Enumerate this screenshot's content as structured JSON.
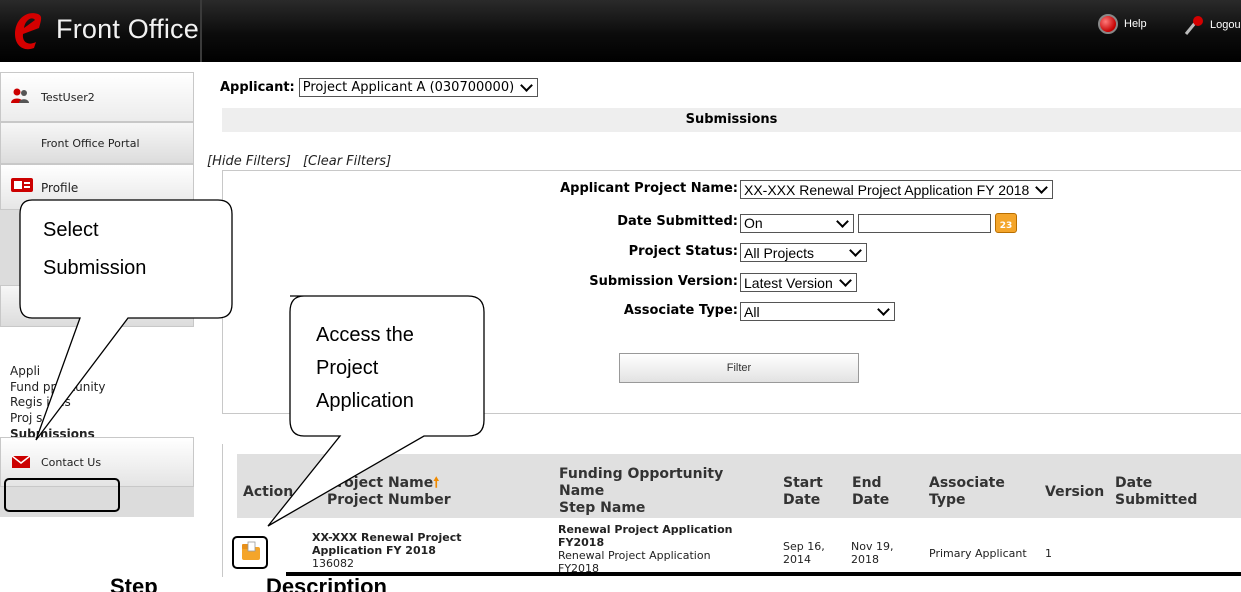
{
  "header": {
    "logo_letter": "e",
    "app_title": "Front Office",
    "help_label": "Help",
    "logout_label": "Logou"
  },
  "sidebar": {
    "user_name": "TestUser2",
    "portal_label": "Front Office Portal",
    "profile_label": "Profile",
    "links": [
      "Appli",
      "Fund  pportunity",
      "Regis   ions",
      "Proj   s",
      "Submissions"
    ],
    "contact_label": "Contact Us"
  },
  "main": {
    "applicant_label": "Applicant:",
    "applicant_value": "Project Applicant A (030700000)",
    "section_title": "Submissions",
    "hide_filters": "[Hide Filters]",
    "clear_filters": "[Clear Filters]",
    "filters": {
      "project_name_label": "Applicant Project Name:",
      "project_name_value": "XX-XXX Renewal Project Application FY 2018",
      "date_label": "Date Submitted:",
      "date_mode": "On",
      "date_value": "",
      "calendar_day": "23",
      "status_label": "Project Status:",
      "status_value": "All Projects",
      "version_label": "Submission Version:",
      "version_value": "Latest Version",
      "associate_label": "Associate Type:",
      "associate_value": "All",
      "filter_button": "Filter"
    }
  },
  "table": {
    "headers": {
      "action": "Action",
      "project_name": "Project Name",
      "project_number": "Project Number",
      "funding_1": "Funding Opportunity",
      "funding_2": "Name",
      "step_name": "Step Name",
      "start_1": "Start",
      "start_2": "Date",
      "end_1": "End",
      "end_2": "Date",
      "assoc_1": "Associate",
      "assoc_2": "Type",
      "version": "Version",
      "submitted_1": "Date",
      "submitted_2": "Submitted"
    },
    "rows": [
      {
        "project_name_1": "XX-XXX Renewal Project",
        "project_name_2": "Application FY 2018",
        "project_number": "136082",
        "funding_1": "Renewal Project Application",
        "funding_2": "FY2018",
        "step_1": "Renewal Project Application",
        "step_2": "FY2018",
        "start_1": "Sep 16,",
        "start_2": "2014",
        "end_1": "Nov 19,",
        "end_2": "2018",
        "associate": "Primary Applicant",
        "version": "1",
        "submitted": ""
      }
    ]
  },
  "callouts": {
    "select_1": "Select",
    "select_2": "Submission",
    "access_1": "Access the",
    "access_2": "Project",
    "access_3": "Application"
  },
  "footer": {
    "step": "Step",
    "description": "Description"
  },
  "colors": {
    "header_bg": "#000000",
    "logo_red": "#d40000",
    "sort_arrow": "#f08a00",
    "calendar": "#f4a52a"
  }
}
